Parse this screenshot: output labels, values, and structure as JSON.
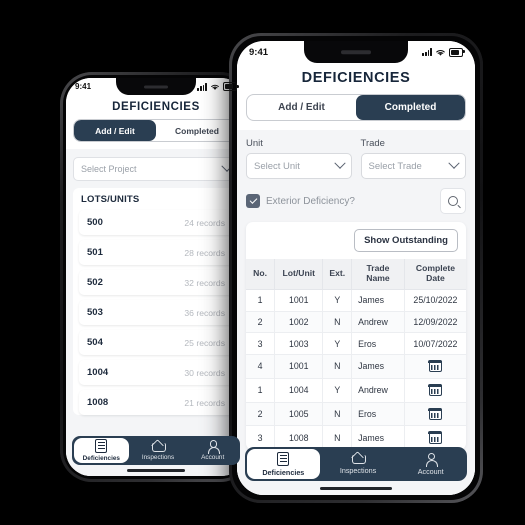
{
  "back_phone": {
    "status_bar": {
      "time": "9:41",
      "signal_icon": "cellular-signal-icon",
      "wifi_icon": "wifi-icon",
      "battery_icon": "battery-icon"
    },
    "app_title": "DEFICIENCIES",
    "segmented": {
      "options": [
        "Add / Edit",
        "Completed"
      ],
      "active": "Add / Edit"
    },
    "project_select": {
      "placeholder": "Select Project",
      "chevron_icon": "chevron-down-icon"
    },
    "lots_title": "LOTS/UNITS",
    "lots": [
      {
        "unit": "500",
        "records": "24 records"
      },
      {
        "unit": "501",
        "records": "28 records"
      },
      {
        "unit": "502",
        "records": "32 records"
      },
      {
        "unit": "503",
        "records": "36 records"
      },
      {
        "unit": "504",
        "records": "25 records"
      },
      {
        "unit": "1004",
        "records": "30 records"
      },
      {
        "unit": "1008",
        "records": "21 records"
      }
    ],
    "tabs": [
      {
        "label": "Deficiencies",
        "icon": "document-icon",
        "active": true
      },
      {
        "label": "Inspections",
        "icon": "home-icon",
        "active": false
      },
      {
        "label": "Account",
        "icon": "user-icon",
        "active": false
      }
    ]
  },
  "front_phone": {
    "status_bar": {
      "time": "9:41",
      "signal_icon": "cellular-signal-icon",
      "wifi_icon": "wifi-icon",
      "battery_icon": "battery-icon"
    },
    "app_title": "DEFICIENCIES",
    "segmented": {
      "options": [
        "Add / Edit",
        "Completed"
      ],
      "active": "Completed"
    },
    "filters": {
      "unit": {
        "label": "Unit",
        "placeholder": "Select Unit",
        "chevron_icon": "chevron-down-icon"
      },
      "trade": {
        "label": "Trade",
        "placeholder": "Select Trade",
        "chevron_icon": "chevron-down-icon"
      }
    },
    "checkbox": {
      "label": "Exterior Deficiency?",
      "checked": true
    },
    "search_button": {
      "icon": "search-icon"
    },
    "show_outstanding_button": "Show Outstanding",
    "table": {
      "headers": [
        "No.",
        "Lot/Unit",
        "Ext.",
        "Trade Name",
        "Complete Date"
      ],
      "rows": [
        {
          "no": "1",
          "lot_unit": "1001",
          "ext": "Y",
          "trade_name": "James",
          "complete_date": "25/10/2022",
          "date_is_icon": false
        },
        {
          "no": "2",
          "lot_unit": "1002",
          "ext": "N",
          "trade_name": "Andrew",
          "complete_date": "12/09/2022",
          "date_is_icon": false
        },
        {
          "no": "3",
          "lot_unit": "1003",
          "ext": "Y",
          "trade_name": "Eros",
          "complete_date": "10/07/2022",
          "date_is_icon": false
        },
        {
          "no": "4",
          "lot_unit": "1001",
          "ext": "N",
          "trade_name": "James",
          "complete_date": "",
          "date_is_icon": true
        },
        {
          "no": "1",
          "lot_unit": "1004",
          "ext": "Y",
          "trade_name": "Andrew",
          "complete_date": "",
          "date_is_icon": true
        },
        {
          "no": "2",
          "lot_unit": "1005",
          "ext": "N",
          "trade_name": "Eros",
          "complete_date": "",
          "date_is_icon": true
        },
        {
          "no": "3",
          "lot_unit": "1008",
          "ext": "N",
          "trade_name": "James",
          "complete_date": "",
          "date_is_icon": true
        }
      ]
    },
    "tabs": [
      {
        "label": "Deficiencies",
        "icon": "document-icon",
        "active": true
      },
      {
        "label": "Inspections",
        "icon": "home-icon",
        "active": false
      },
      {
        "label": "Account",
        "icon": "user-icon",
        "active": false
      }
    ]
  },
  "theme": {
    "navy": "#2a3e52",
    "page_bg": "#f4f5f7",
    "muted": "#9aa0a8",
    "border": "#e4e6ea"
  }
}
